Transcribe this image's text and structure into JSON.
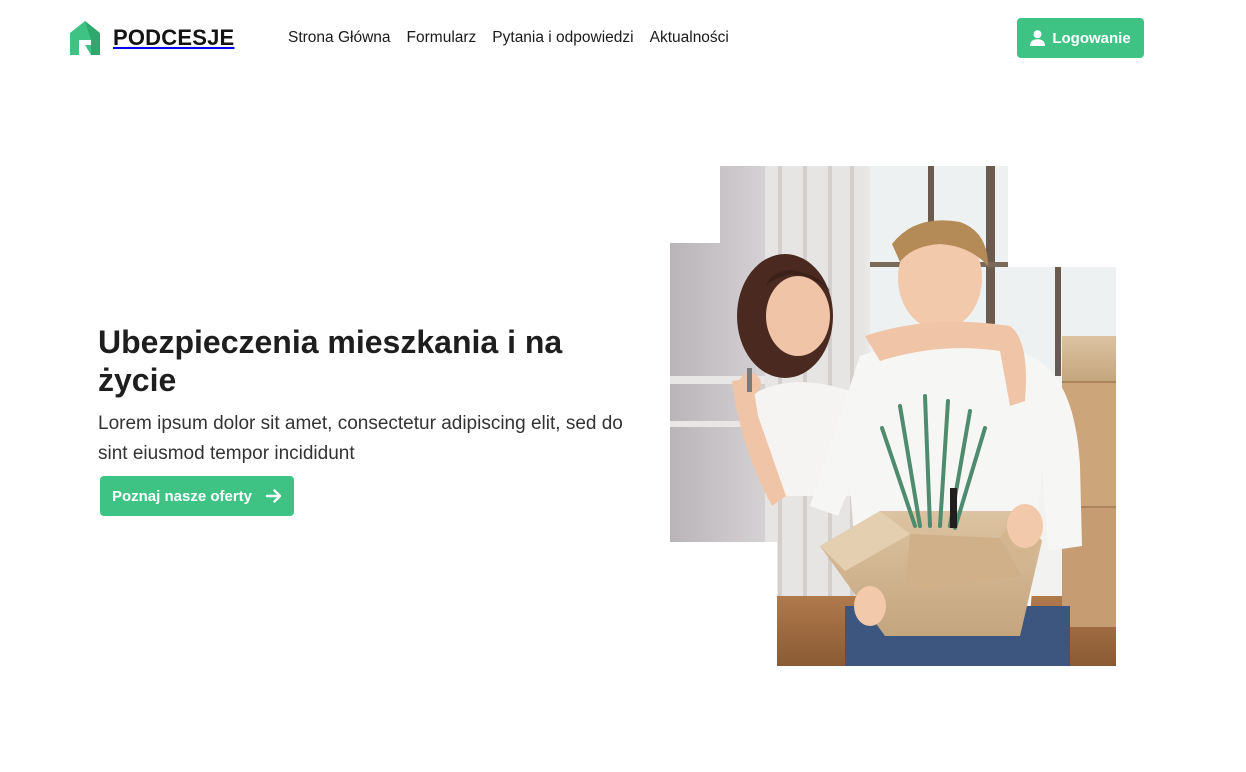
{
  "brand": {
    "name": "PODCESJE",
    "logo_icon": "house-logo-icon",
    "accent_color": "#3fc384"
  },
  "nav": {
    "items": [
      {
        "label": "Strona Główna"
      },
      {
        "label": "Formularz"
      },
      {
        "label": "Pytania i odpowiedzi"
      },
      {
        "label": "Aktualności"
      }
    ]
  },
  "header": {
    "login_label": "Logowanie",
    "login_icon": "user-icon"
  },
  "hero": {
    "title": "Ubezpieczenia mieszkania i na życie",
    "description": "Lorem ipsum dolor sit amet, consectetur adipiscing elit, sed do sint eiusmod tempor incididunt",
    "cta_label": "Poznaj nasze oferty",
    "cta_icon": "arrow-right-icon",
    "image_icon": "couple-moving-photo"
  }
}
